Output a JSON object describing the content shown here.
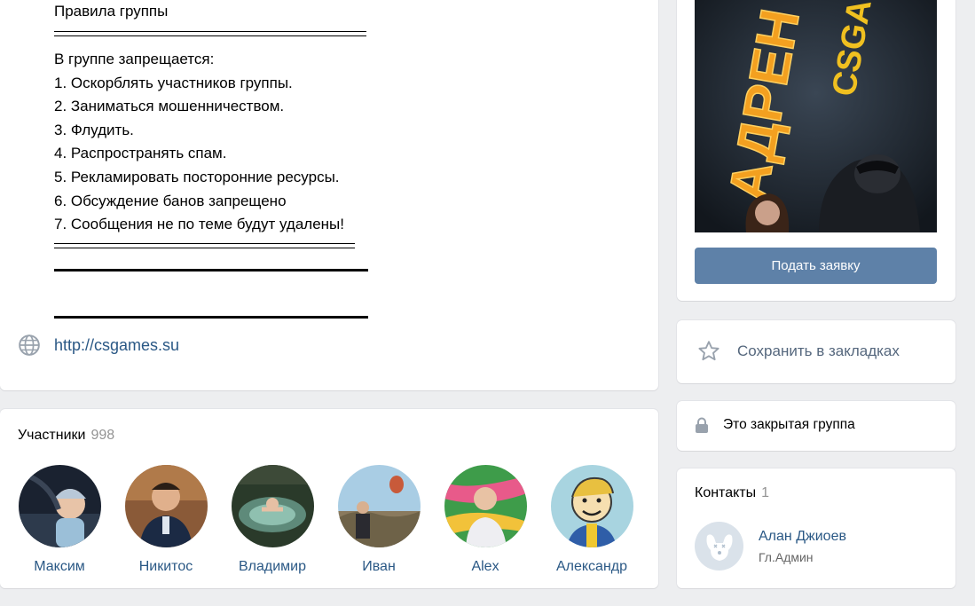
{
  "rules": {
    "title": "Правила группы",
    "items": [
      "В группе запрещается:",
      "1. Оскорблять участников группы.",
      "2. Заниматься мошенничеством.",
      "3. Флудить.",
      "4. Распространять спам.",
      "5. Рекламировать посторонние ресурсы.",
      "6. Обсуждение банов запрещено",
      "7. Сообщения не по теме будут удалены!"
    ],
    "website": "http://csgames.su"
  },
  "members": {
    "title": "Участники",
    "count": "998",
    "list": [
      {
        "name": "Максим"
      },
      {
        "name": "Никитос"
      },
      {
        "name": "Владимир"
      },
      {
        "name": "Иван"
      },
      {
        "name": "Alex"
      },
      {
        "name": "Александр"
      }
    ]
  },
  "cover": {
    "text_main": "АДРЕН",
    "text_sub": "CSGA"
  },
  "actions": {
    "apply_label": "Подать заявку",
    "bookmark_label": "Сохранить в закладках",
    "closed_label": "Это закрытая группа"
  },
  "contacts": {
    "title": "Контакты",
    "count": "1",
    "person": {
      "name": "Алан Джиоев",
      "role": "Гл.Админ"
    }
  },
  "colors": {
    "link": "#2a5885",
    "button": "#5e81a8",
    "background": "#edeef0"
  }
}
